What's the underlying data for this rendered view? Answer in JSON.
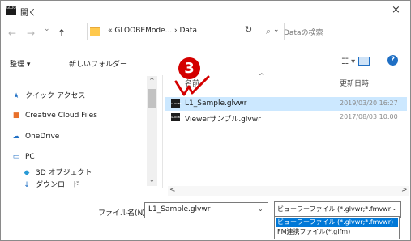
{
  "window": {
    "app_icon_text": "GLOOBE",
    "title": "開く",
    "close_glyph": "×"
  },
  "nav": {
    "back_glyph": "←",
    "forward_glyph": "→",
    "chevron_glyph": "⌄",
    "up_glyph": "↑",
    "address": "« GLOOBEMode... › Data",
    "address_dropdown": "⌄",
    "refresh_glyph": "↻",
    "search_glyph": "⌕",
    "search_placeholder": "Dataの検索"
  },
  "toolbar": {
    "organize": "整理 ▾",
    "new_folder": "新しいフォルダー",
    "view_glyph": "☷ ▾",
    "help_glyph": "?"
  },
  "sidebar": {
    "items": [
      {
        "icon": "★",
        "label": "クイック アクセス"
      },
      {
        "icon": "■",
        "label": "Creative Cloud Files"
      },
      {
        "icon": "☁",
        "label": "OneDrive"
      },
      {
        "icon": "▭",
        "label": "PC"
      },
      {
        "icon": "◆",
        "label": "3D オブジェクト"
      },
      {
        "icon": "↓",
        "label": "ダウンロード"
      }
    ],
    "scroll_up": "^",
    "scroll_down": "⌄"
  },
  "file_list": {
    "header_name": "名前",
    "header_sort": "^",
    "header_date": "更新日時",
    "rows": [
      {
        "icon_text": "GLOOBE",
        "name": "L1_Sample.glvwr",
        "date": "2019/03/20 16:27",
        "selected": true
      },
      {
        "icon_text": "GLOOBE",
        "name": "Viewerサンプル.glvwr",
        "date": "2017/08/03 10:00",
        "selected": false
      }
    ],
    "scroll_left": "<",
    "scroll_right": ">"
  },
  "annotation": {
    "badge_number": "3",
    "badge_color": "#d40000",
    "check_color": "#d40000"
  },
  "footer": {
    "filename_label": "ファイル名(N):",
    "filename_value": "L1_Sample.glvwr",
    "filename_dropdown": "⌄",
    "filetype_value": "ビューワーファイル (*.glvwr;*.fmvwr",
    "filetype_dropdown": "⌄",
    "filetype_options": [
      {
        "label": "ビューワーファイル (*.glvwr;*.fmvwr)",
        "highlighted": true
      },
      {
        "label": "FM連携ファイル(*.glfm)",
        "highlighted": false
      }
    ]
  },
  "colors": {
    "selection": "#cce8ff",
    "accent": "#0078d7"
  }
}
